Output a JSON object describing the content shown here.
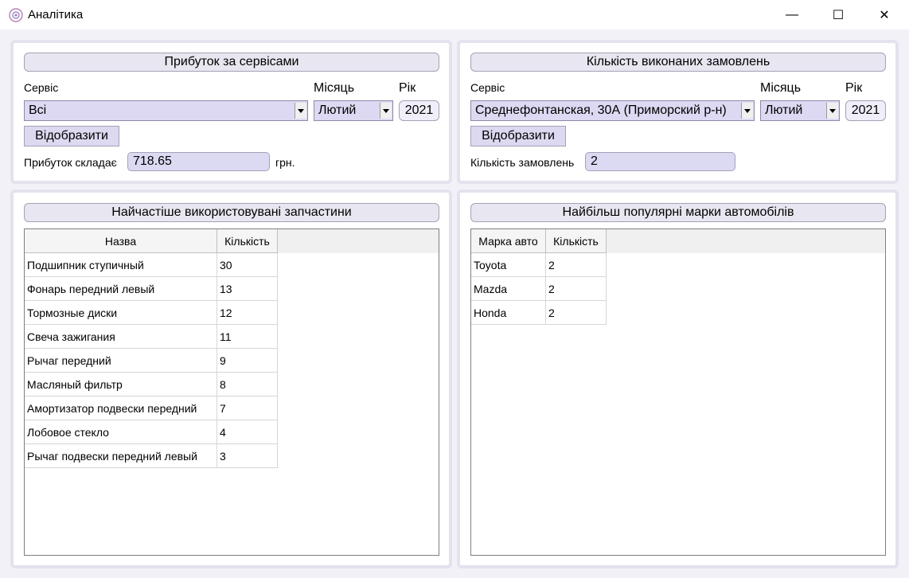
{
  "window": {
    "title": "Аналітика",
    "min_glyph": "—",
    "max_glyph": "☐",
    "close_glyph": "✕"
  },
  "profit": {
    "header": "Прибуток за сервісами",
    "service_label": "Сервіс",
    "month_label": "Місяць",
    "year_label": "Рік",
    "service_value": "Всі",
    "month_value": "Лютий",
    "year_value": "2021",
    "show_button": "Відобразити",
    "result_label": "Прибуток складає",
    "result_value": "718.65",
    "unit": "грн."
  },
  "orders": {
    "header": "Кількість виконаних замовлень",
    "service_label": "Сервіс",
    "month_label": "Місяць",
    "year_label": "Рік",
    "service_value": "Среднефонтанская, 30А (Приморский р-н)",
    "month_value": "Лютий",
    "year_value": "2021",
    "show_button": "Відобразити",
    "result_label": "Кількість замовлень",
    "result_value": "2"
  },
  "parts": {
    "header": "Найчастіше використовувані запчастини",
    "columns": [
      "Назва",
      "Кількість"
    ],
    "rows": [
      [
        "Подшипник ступичный",
        "30"
      ],
      [
        "Фонарь передний левый",
        "13"
      ],
      [
        "Тормозные диски",
        "12"
      ],
      [
        "Свеча зажигания",
        "11"
      ],
      [
        "Рычаг передний",
        "9"
      ],
      [
        "Масляный фильтр",
        "8"
      ],
      [
        "Амортизатор подвески передний",
        "7"
      ],
      [
        "Лобовое стекло",
        "4"
      ],
      [
        "Рычаг подвески передний левый",
        "3"
      ]
    ]
  },
  "brands": {
    "header": "Найбільш популярні марки автомобілів",
    "columns": [
      "Марка авто",
      "Кількість"
    ],
    "rows": [
      [
        "Toyota",
        "2"
      ],
      [
        "Mazda",
        "2"
      ],
      [
        "Honda",
        "2"
      ]
    ]
  }
}
